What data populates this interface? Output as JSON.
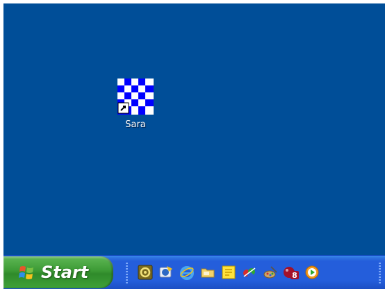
{
  "desktop": {
    "background_color": "#004e98",
    "icons": [
      {
        "label": "Sara",
        "icon": "checkerboard-shortcut-icon"
      }
    ]
  },
  "taskbar": {
    "start_label": "Start",
    "quick_launch": [
      {
        "name": "media-center-icon"
      },
      {
        "name": "outlook-express-icon"
      },
      {
        "name": "internet-explorer-icon"
      },
      {
        "name": "folder-icon"
      },
      {
        "name": "sticky-notes-icon"
      },
      {
        "name": "games-icon"
      },
      {
        "name": "paint-icon"
      },
      {
        "name": "network-badge-icon",
        "badge": "8"
      },
      {
        "name": "media-player-icon"
      }
    ]
  }
}
